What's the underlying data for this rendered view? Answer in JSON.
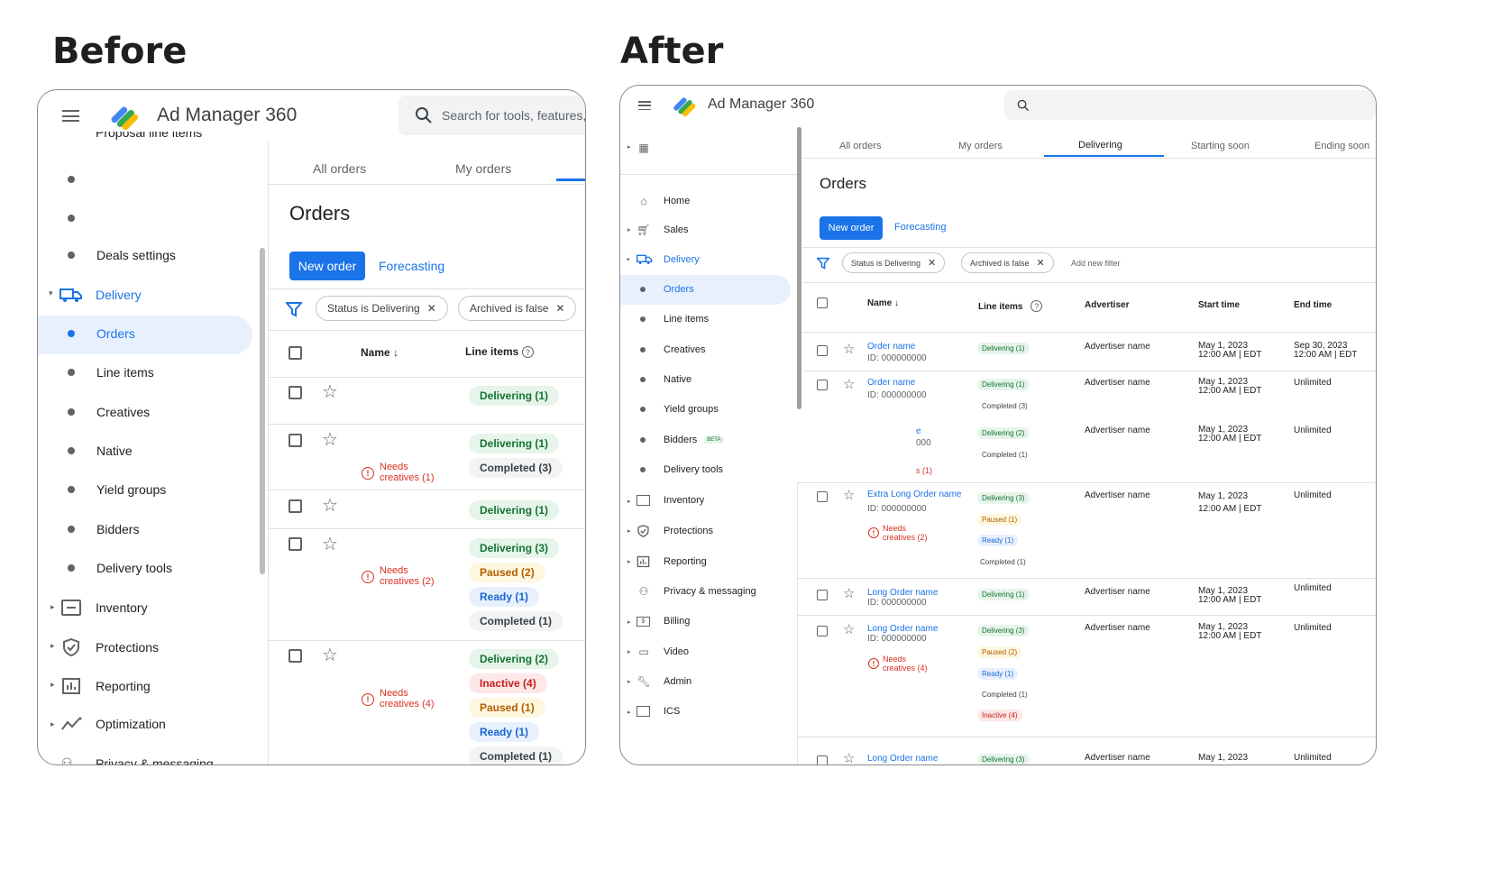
{
  "labels": {
    "before": "Before",
    "after": "After"
  },
  "before": {
    "app_title": "Ad Manager 360",
    "search_placeholder": "Search for tools, features,",
    "nav_cut_top": "Proposal line items",
    "nav": {
      "deals_settings": "Deals settings",
      "delivery": "Delivery",
      "orders": "Orders",
      "line_items": "Line items",
      "creatives": "Creatives",
      "native": "Native",
      "yield_groups": "Yield groups",
      "bidders": "Bidders",
      "delivery_tools": "Delivery tools",
      "inventory": "Inventory",
      "protections": "Protections",
      "reporting": "Reporting",
      "optimization": "Optimization",
      "privacy": "Privacy & messaging"
    },
    "tabs": {
      "all_orders": "All orders",
      "my_orders": "My orders"
    },
    "page_title": "Orders",
    "new_order": "New order",
    "forecasting": "Forecasting",
    "filters": {
      "status": "Status is Delivering",
      "archived": "Archived is false"
    },
    "columns": {
      "name": "Name",
      "line_items": "Line items"
    },
    "needs": [
      "Needs",
      "creatives (1)",
      "creatives (2)",
      "creatives (4)"
    ],
    "pills": {
      "r1": [
        "Delivering (1)"
      ],
      "r2": [
        "Delivering (1)",
        "Completed (3)"
      ],
      "r3": [
        "Delivering (1)"
      ],
      "r4": [
        "Delivering (3)",
        "Paused (2)",
        "Ready (1)",
        "Completed (1)"
      ],
      "r5": [
        "Delivering (2)",
        "Inactive (4)",
        "Paused (1)",
        "Ready (1)",
        "Completed (1)"
      ]
    }
  },
  "after": {
    "app_title": "Ad Manager 360",
    "nav": {
      "home": "Home",
      "sales": "Sales",
      "delivery": "Delivery",
      "orders": "Orders",
      "line_items": "Line items",
      "creatives": "Creatives",
      "native": "Native",
      "yield_groups": "Yield groups",
      "bidders": "Bidders",
      "beta": "BETA",
      "delivery_tools": "Delivery tools",
      "inventory": "Inventory",
      "protections": "Protections",
      "reporting": "Reporting",
      "privacy": "Privacy & messaging",
      "billing": "Billing",
      "video": "Video",
      "admin": "Admin",
      "ics": "ICS"
    },
    "tabs": {
      "all_orders": "All orders",
      "my_orders": "My orders",
      "delivering": "Delivering",
      "starting_soon": "Starting soon",
      "ending_soon": "Ending soon"
    },
    "page_title": "Orders",
    "new_order": "New order",
    "forecasting": "Forecasting",
    "filters": {
      "status": "Status is Delivering",
      "archived": "Archived is false",
      "add": "Add new filter"
    },
    "columns": {
      "name": "Name",
      "line_items": "Line items",
      "advertiser": "Advertiser",
      "start": "Start time",
      "end": "End time"
    },
    "rows": [
      {
        "name": "Order name",
        "id": "ID: 000000000",
        "adv": "Advertiser name",
        "start1": "May 1, 2023",
        "start2": "12:00 AM | EDT",
        "end1": "Sep 30, 2023",
        "end2": "12:00 AM | EDT",
        "pills": [
          "Delivering (1)"
        ]
      },
      {
        "name": "Order name",
        "id": "ID: 000000000",
        "adv": "Advertiser name",
        "start1": "May 1, 2023",
        "start2": "12:00 AM | EDT",
        "end1": "Unlimited",
        "pills": [
          "Delivering (1)",
          "Completed (3)"
        ]
      },
      {
        "name": "e",
        "id": "000",
        "adv": "Advertiser name",
        "start1": "May 1, 2023",
        "start2": "12:00 AM | EDT",
        "end1": "Unlimited",
        "warn": "s (1)",
        "pills": [
          "Delivering (2)",
          "Completed (1)"
        ]
      },
      {
        "name": "Extra Long Order name",
        "id": "ID: 000000000",
        "adv": "Advertiser name",
        "start1": "May 1, 2023",
        "start2": "12:00 AM | EDT",
        "end1": "Unlimited",
        "warn1": "Needs",
        "warn2": "creatives (2)",
        "pills": [
          "Delivering (3)",
          "Paused (1)",
          "Ready (1)",
          "Completed (1)"
        ]
      },
      {
        "name": "Long Order name",
        "id": "ID: 000000000",
        "adv": "Advertiser name",
        "start1": "May 1, 2023",
        "start2": "12:00 AM | EDT",
        "end1": "Unlimited",
        "pills": [
          "Delivering (1)"
        ]
      },
      {
        "name": "Long Order name",
        "id": "ID: 000000000",
        "adv": "Advertiser name",
        "start1": "May 1, 2023",
        "start2": "12:00 AM | EDT",
        "end1": "Unlimited",
        "warn1": "Needs",
        "warn2": "creatives (4)",
        "pills": [
          "Delivering (3)",
          "Paused (2)",
          "Ready (1)",
          "Completed (1)",
          "Inactive (4)"
        ]
      },
      {
        "name": "Long Order name",
        "adv": "Advertiser name",
        "start1": "May 1, 2023",
        "end1": "Unlimited",
        "pills": [
          "Delivering (3)"
        ]
      }
    ]
  },
  "colors": {
    "accent": "#1a73e8",
    "green": "#137333",
    "red": "#d93025"
  }
}
